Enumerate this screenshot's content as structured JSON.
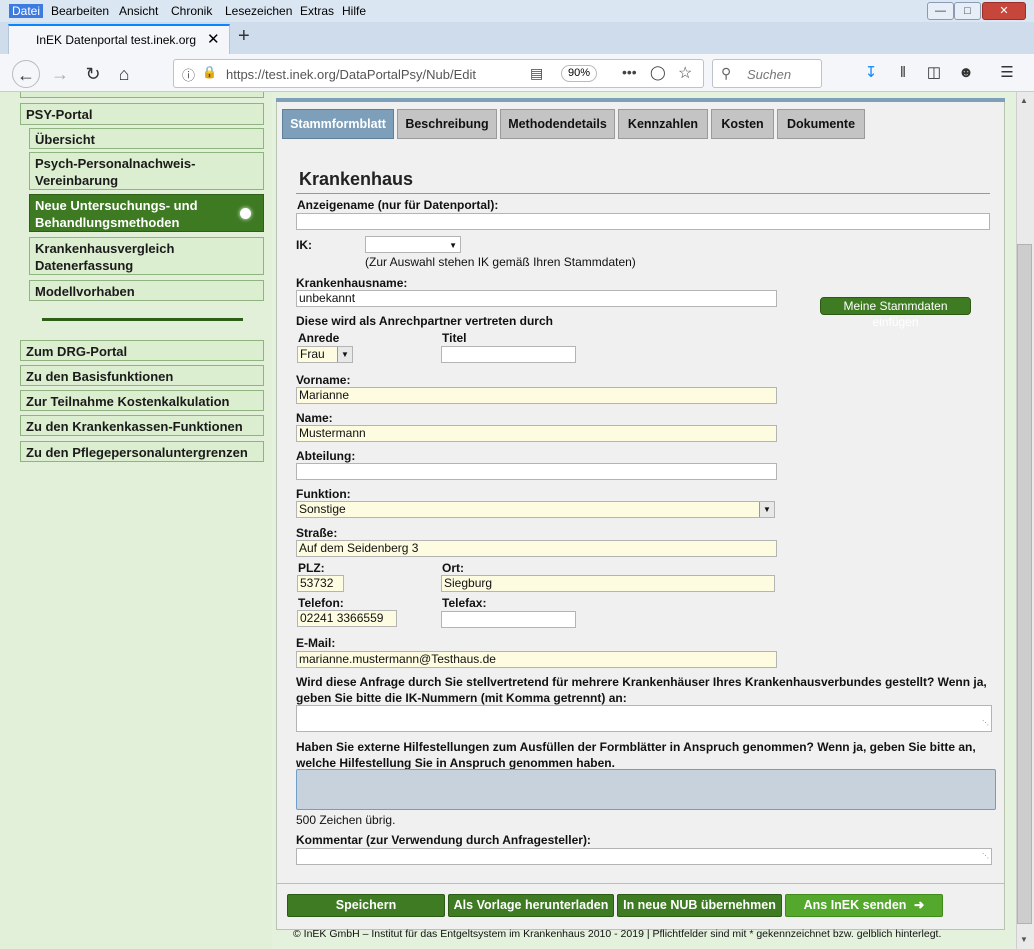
{
  "menu": [
    "Datei",
    "Bearbeiten",
    "Ansicht",
    "Chronik",
    "Lesezeichen",
    "Extras",
    "Hilfe"
  ],
  "tab": {
    "title": "InEK Datenportal test.inek.org"
  },
  "toolbar": {
    "url": "https://test.inek.org/DataPortalPsy/Nub/Edit",
    "zoom": "90%",
    "search_placeholder": "Suchen"
  },
  "sidebar": {
    "top_label": "PSY-Portal",
    "items": [
      "Übersicht",
      "Psych-Personalnachweis-Vereinbarung",
      "Neue Untersuchungs- und Behandlungsmethoden",
      "Krankenhausvergleich Datenerfassung",
      "Modellvorhaben"
    ],
    "links": [
      "Zum DRG-Portal",
      "Zu den Basisfunktionen",
      "Zur Teilnahme Kostenkalkulation",
      "Zu den Krankenkassen-Funktionen",
      "Zu den Pflegepersonaluntergrenzen"
    ]
  },
  "tabs": [
    "Stammformblatt",
    "Beschreibung",
    "Methodendetails",
    "Kennzahlen",
    "Kosten",
    "Dokumente"
  ],
  "form": {
    "section_title": "Krankenhaus",
    "anzeigename_label": "Anzeigename (nur für Datenportal):",
    "ik_label": "IK:",
    "ik_hint": "(Zur Auswahl stehen IK gemäß Ihren Stammdaten)",
    "khname_label": "Krankenhausname:",
    "khname_value": "unbekannt",
    "stammdaten_button": "Meine Stammdaten einfügen",
    "contact_heading": "Diese wird als Anrechpartner vertreten durch",
    "anrede_label": "Anrede",
    "anrede_value": "Frau",
    "titel_label": "Titel",
    "vorname_label": "Vorname:",
    "vorname_value": "Marianne",
    "name_label": "Name:",
    "name_value": "Mustermann",
    "abteilung_label": "Abteilung:",
    "funktion_label": "Funktion:",
    "funktion_value": "Sonstige",
    "strasse_label": "Straße:",
    "strasse_value": "Auf dem Seidenberg 3",
    "plz_label": "PLZ:",
    "plz_value": "53732",
    "ort_label": "Ort:",
    "ort_value": "Siegburg",
    "telefon_label": "Telefon:",
    "telefon_value": "02241 3366559",
    "telefax_label": "Telefax:",
    "email_label": "E-Mail:",
    "email_value": "marianne.mustermann@Testhaus.de",
    "verbund_question": "Wird diese Anfrage durch Sie stellvertretend für mehrere Krankenhäuser Ihres Krankenhausverbundes gestellt? Wenn ja, geben Sie bitte die IK-Nummern (mit Komma getrennt) an:",
    "hilfe_question": "Haben Sie externe Hilfestellungen zum Ausfüllen der Formblätter in Anspruch genommen? Wenn ja, geben Sie bitte an, welche Hilfestellung Sie in Anspruch genommen haben.",
    "chars_left": "500 Zeichen übrig.",
    "kommentar_label": "Kommentar (zur Verwendung durch Anfragesteller):"
  },
  "actions": [
    "Speichern",
    "Als Vorlage herunterladen",
    "In neue NUB übernehmen",
    "Ans InEK senden"
  ],
  "footer": "© InEK GmbH – Institut für das Entgeltsystem im Krankenhaus 2010 - 2019 | Pflichtfelder sind mit * gekennzeichnet bzw. gelblich hinterlegt."
}
